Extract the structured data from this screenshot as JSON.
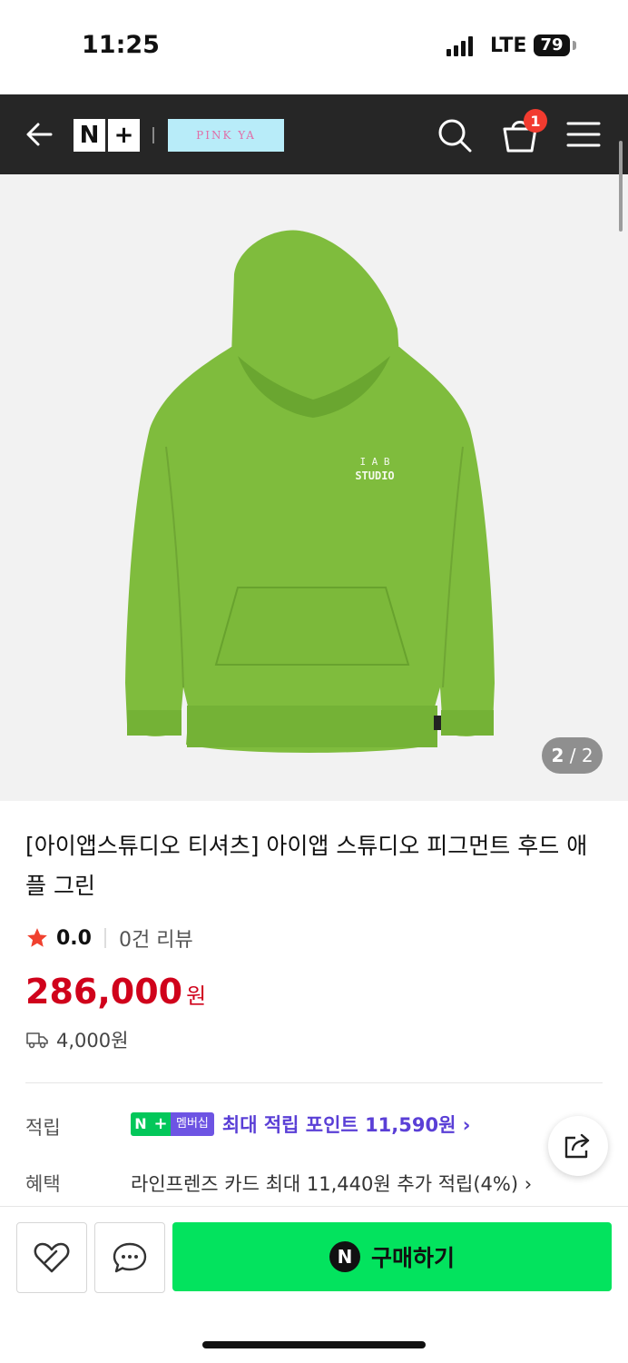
{
  "status_bar": {
    "time": "11:25",
    "network": "LTE",
    "battery": "79"
  },
  "header": {
    "logo_left": "N",
    "logo_right": "+",
    "store_logo": "PINK YA",
    "cart_count": "1",
    "icons": [
      "back-arrow-icon",
      "search-icon",
      "cart-icon",
      "menu-icon"
    ]
  },
  "gallery": {
    "current": "2",
    "total": "/ 2",
    "print_line1": "I A B",
    "print_line2": "STUDIO"
  },
  "product": {
    "title": "[아이앱스튜디오 티셔츠] 아이앱 스튜디오 피그먼트 후드 애플 그린",
    "rating": "0.0",
    "review_count": "0건 리뷰",
    "price": "286,000",
    "price_unit": "원",
    "shipping_fee": "4,000원"
  },
  "info": {
    "points_label": "적립",
    "member_n": "N",
    "member_plus": "+",
    "member_text": "멤버십",
    "points_text": "최대 적립 포인트 11,590원 ›",
    "benefit_label": "혜택",
    "benefit_text": "라인프렌즈 카드 최대 11,440원 추가 적립(4%) ›"
  },
  "bottom": {
    "npay_icon": "N",
    "buy_label": "구매하기"
  },
  "colors": {
    "topbar": "#262626",
    "price": "#d0021b",
    "buy_button": "#03e35e",
    "points_purple": "#5a3fd6",
    "naver_green": "#03c75a",
    "hoodie_green": "#7fbc3d"
  }
}
